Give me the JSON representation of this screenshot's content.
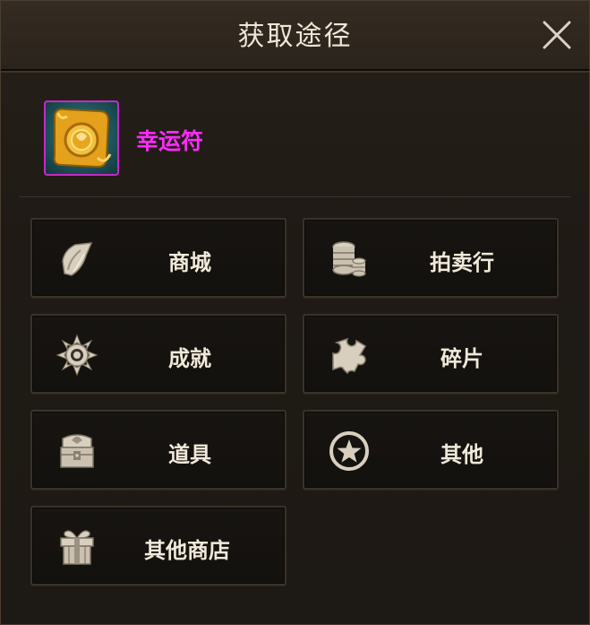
{
  "dialog": {
    "title": "获取途径"
  },
  "item": {
    "name": "幸运符",
    "name_color": "#ff2bff",
    "rarity_border_color": "#c628c8"
  },
  "sources": [
    {
      "label": "商城",
      "icon": "crystal-shard-icon"
    },
    {
      "label": "拍卖行",
      "icon": "coin-stack-icon"
    },
    {
      "label": "成就",
      "icon": "medal-emblem-icon"
    },
    {
      "label": "碎片",
      "icon": "puzzle-piece-icon"
    },
    {
      "label": "道具",
      "icon": "treasure-chest-icon"
    },
    {
      "label": "其他",
      "icon": "star-circle-icon"
    },
    {
      "label": "其他商店",
      "icon": "gift-box-icon"
    }
  ],
  "colors": {
    "icon_fill": "#d8cfbf",
    "label_text": "#f1e9da"
  }
}
